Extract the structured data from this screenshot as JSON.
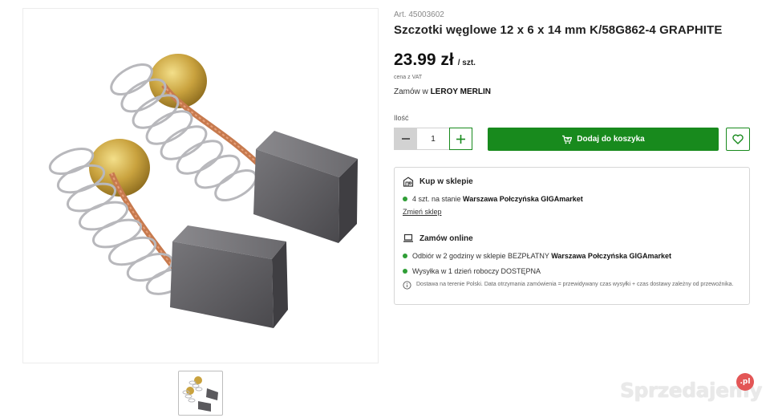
{
  "product": {
    "article": "Art. 45003602",
    "title": "Szczotki węglowe 12 x 6 x 14 mm K/58G862-4 GRAPHITE",
    "price": "23.99 zł",
    "unit": "/ szt.",
    "vat_note": "cena z VAT",
    "order_in_prefix": "Zamów w ",
    "order_in_store": "LEROY MERLIN"
  },
  "quantity": {
    "label": "Ilość",
    "value": "1"
  },
  "actions": {
    "add_to_cart": "Dodaj do koszyka"
  },
  "store_pickup": {
    "heading": "Kup w sklepie",
    "stock_text": "4 szt. na stanie ",
    "store_name": "Warszawa Połczyńska GIGAmarket",
    "change_store": "Zmień sklep"
  },
  "online": {
    "heading": "Zamów online",
    "pickup_text": "Odbiór w 2 godziny w sklepie BEZPŁATNY ",
    "pickup_store": "Warszawa Połczyńska GIGAmarket",
    "shipping": "Wysyłka w 1 dzień roboczy DOSTĘPNA",
    "note": "Dostawa na terenie Polski. Data otrzymania zamówienia = przewidywany czas wysyłki + czas dostawy zależny od przewoźnika."
  },
  "watermark": {
    "text": "Sprzedajemy",
    "badge": ".pl"
  },
  "colors": {
    "brand_green": "#188a1d",
    "status_green": "#2f9e36"
  },
  "icons": [
    "cart-icon",
    "heart-icon",
    "store-icon",
    "laptop-icon",
    "info-icon",
    "minus-icon",
    "plus-icon"
  ]
}
